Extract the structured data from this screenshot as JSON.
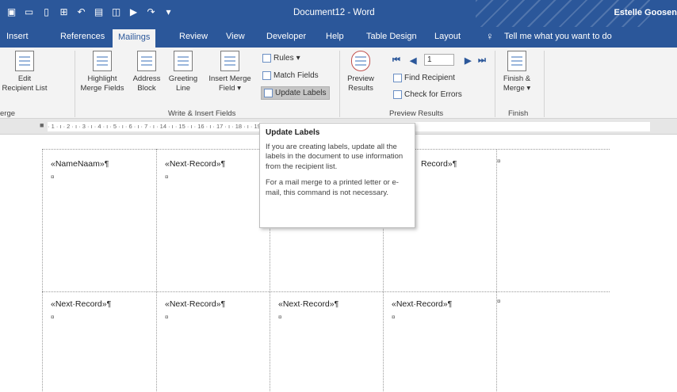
{
  "titlebar": {
    "document_title": "Document12  -  Word",
    "user_name": "Estelle Goosen",
    "accent_color": "#2b579a"
  },
  "tabs": [
    {
      "label": "Insert"
    },
    {
      "label": "References"
    },
    {
      "label": "Mailings",
      "active": true
    },
    {
      "label": "Review"
    },
    {
      "label": "View"
    },
    {
      "label": "Developer"
    },
    {
      "label": "Help"
    },
    {
      "label": "Table Design"
    },
    {
      "label": "Layout"
    }
  ],
  "tell_me": "Tell me what you want to do",
  "ribbon": {
    "edit_recipient_list": "Edit\nRecipient List",
    "edit_recipient_line1": "Edit",
    "edit_recipient_line2": "Recipient List",
    "start_group_label": "erge",
    "highlight_line1": "Highlight",
    "highlight_line2": "Merge Fields",
    "address_line1": "Address",
    "address_line2": "Block",
    "greeting_line1": "Greeting",
    "greeting_line2": "Line",
    "insert_merge_line1": "Insert Merge",
    "insert_merge_line2": "Field",
    "rules": "Rules",
    "match_fields": "Match Fields",
    "update_labels": "Update Labels",
    "write_group_label": "Write & Insert Fields",
    "preview_line1": "Preview",
    "preview_line2": "Results",
    "record_number": "1",
    "find_recipient": "Find Recipient",
    "check_errors": "Check for Errors",
    "preview_group_label": "Preview Results",
    "finish_line1": "Finish &",
    "finish_line2": "Merge",
    "finish_group_label": "Finish"
  },
  "ruler_text": "· 1 · ı · 2 · ı · 3 · ı · 4 · ı · 5 · ı · 6 · ı · 7 · ı                                      · 14 · ı · 15 · ı · 16 · ı · 17 · ı · 18 · ı · 19 · ı · 20 · ı ·",
  "tooltip": {
    "title": "Update Labels",
    "body1": "If you are creating labels, update all the labels in the document to use information from the recipient list.",
    "body2": "For a mail merge to a printed letter or e-mail, this command is not necessary."
  },
  "document": {
    "row1": [
      "«NameNaam»¶",
      "«Next·Record»¶",
      "",
      "«Next·Record»¶"
    ],
    "row2": [
      "«Next·Record»¶",
      "«Next·Record»¶",
      "«Next·Record»¶",
      "«Next·Record»¶"
    ],
    "cell_marker": "¤",
    "partial_record": "Record»¶"
  }
}
